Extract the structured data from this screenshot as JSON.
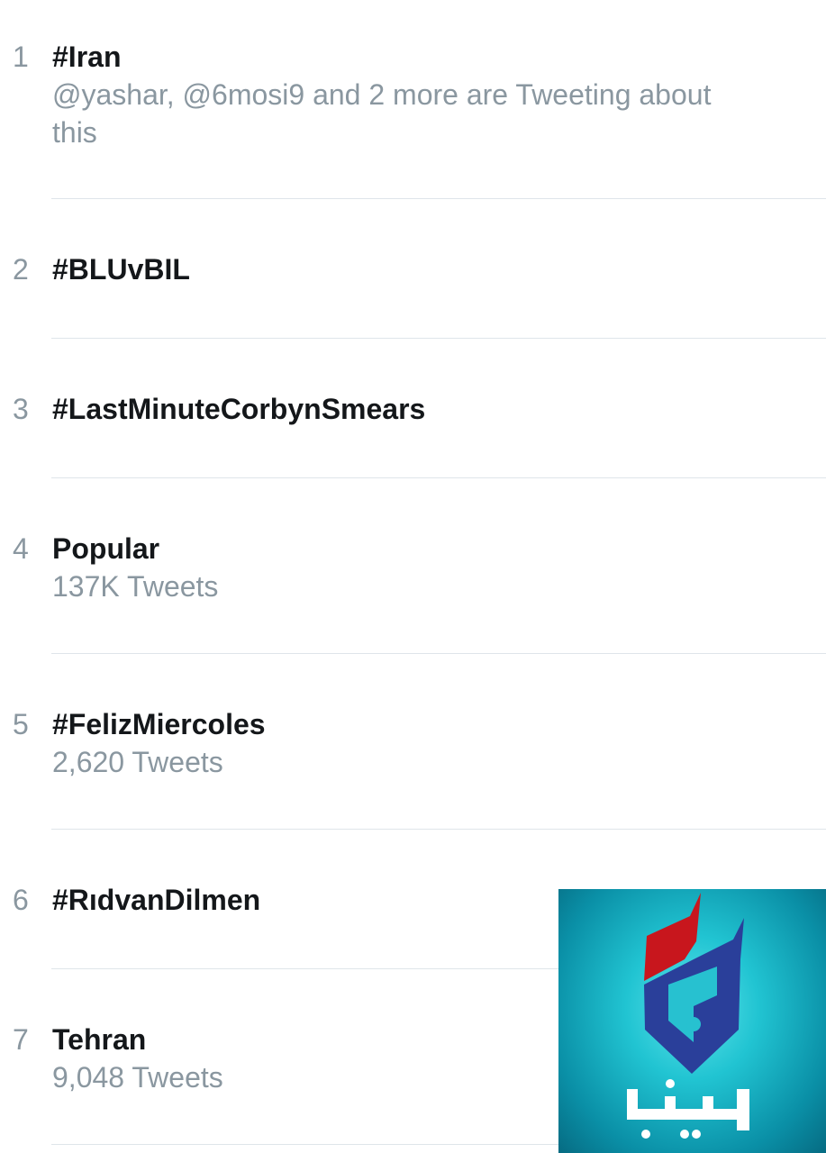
{
  "trends": [
    {
      "rank": "1",
      "name": "#Iran",
      "subtitle": "@yashar, @6mosi9 and 2 more are Tweeting about this"
    },
    {
      "rank": "2",
      "name": "#BLUvBIL",
      "subtitle": ""
    },
    {
      "rank": "3",
      "name": "#LastMinuteCorbynSmears",
      "subtitle": ""
    },
    {
      "rank": "4",
      "name": "Popular",
      "subtitle": "137K Tweets"
    },
    {
      "rank": "5",
      "name": "#FelizMiercoles",
      "subtitle": "2,620 Tweets"
    },
    {
      "rank": "6",
      "name": "#RıdvanDilmen",
      "subtitle": ""
    },
    {
      "rank": "7",
      "name": "Tehran",
      "subtitle": "9,048 Tweets"
    }
  ],
  "logo": {
    "wordmark": "ایلنا",
    "icon": "ilna-logo-icon",
    "colors": {
      "red": "#c8161d",
      "blue": "#2a3f9a",
      "teal": "#1fbfcf"
    }
  },
  "colors": {
    "name_text": "#14171a",
    "secondary_text": "#8a97a0",
    "divider": "#dfe5ea",
    "background": "#ffffff"
  }
}
